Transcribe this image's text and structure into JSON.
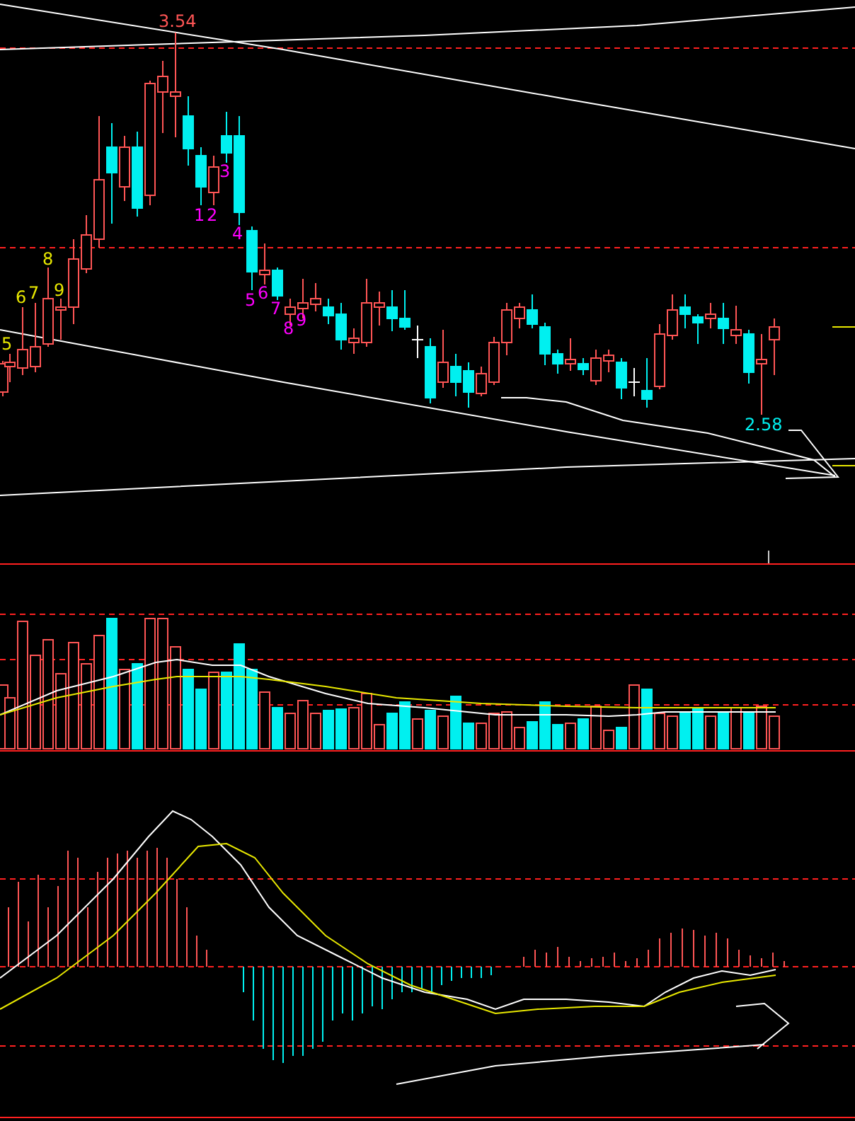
{
  "price_panel": {
    "high_label": "3.54",
    "low_label": "2.58",
    "counts": [
      {
        "text": "5",
        "color": "#e8e800"
      },
      {
        "text": "6",
        "color": "#e8e800"
      },
      {
        "text": "7",
        "color": "#e8e800"
      },
      {
        "text": "8",
        "color": "#e8e800"
      },
      {
        "text": "9",
        "color": "#e8e800"
      },
      {
        "text": "1",
        "color": "#ff00ff"
      },
      {
        "text": "2",
        "color": "#ff00ff"
      },
      {
        "text": "3",
        "color": "#ff00ff"
      },
      {
        "text": "4",
        "color": "#ff00ff"
      },
      {
        "text": "5",
        "color": "#ff00ff"
      },
      {
        "text": "6",
        "color": "#ff00ff"
      },
      {
        "text": "7",
        "color": "#ff00ff"
      },
      {
        "text": "8",
        "color": "#ff00ff"
      },
      {
        "text": "9",
        "color": "#ff00ff"
      }
    ]
  }
}
